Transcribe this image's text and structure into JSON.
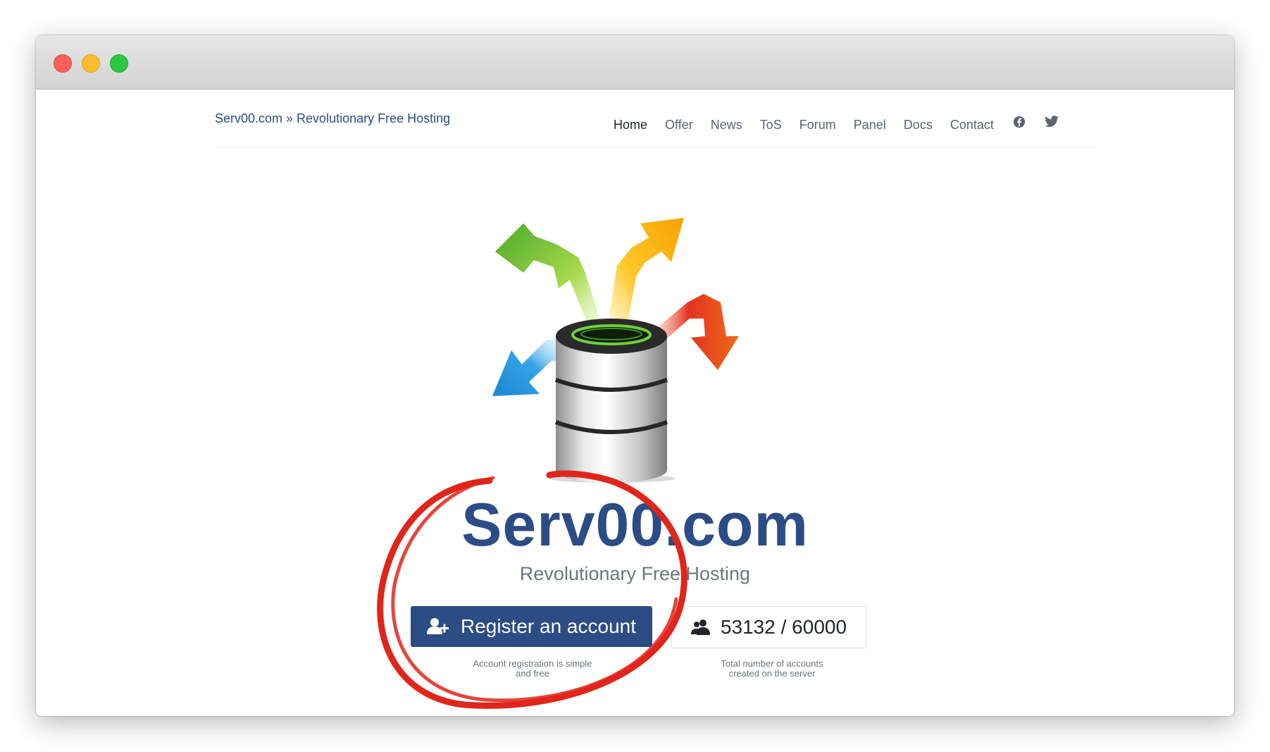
{
  "site": {
    "brand": "Serv00.com » Revolutionary Free Hosting"
  },
  "nav": {
    "items": [
      {
        "label": "Home",
        "active": true
      },
      {
        "label": "Offer"
      },
      {
        "label": "News"
      },
      {
        "label": "ToS"
      },
      {
        "label": "Forum"
      },
      {
        "label": "Panel"
      },
      {
        "label": "Docs"
      },
      {
        "label": "Contact"
      }
    ],
    "social": [
      "facebook-icon",
      "twitter-icon"
    ]
  },
  "hero": {
    "title": "Serv00.com",
    "subtitle": "Revolutionary Free Hosting",
    "register_label": "Register an account",
    "register_caption": "Account registration is simple and free",
    "counter_value": "53132 / 60000",
    "counter_caption": "Total number of accounts created on the server"
  },
  "colors": {
    "brand_blue": "#2c4c86",
    "annotation_red": "#e0251b"
  }
}
